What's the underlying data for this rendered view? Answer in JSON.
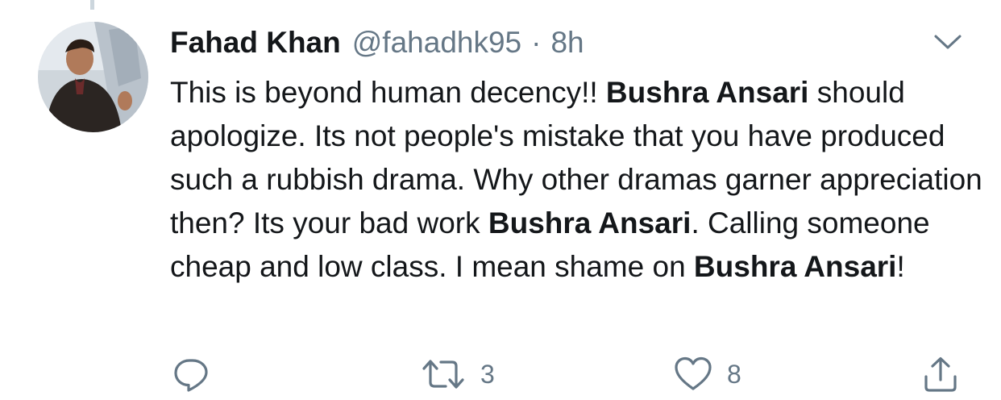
{
  "tweet": {
    "author_name": "Fahad Khan",
    "handle": "@fahadhk95",
    "separator": "·",
    "time": "8h",
    "text_parts": [
      {
        "text": "This is beyond human decency!! ",
        "bold": false
      },
      {
        "text": "Bushra Ansari",
        "bold": true
      },
      {
        "text": " should apologize. Its not people's mistake that you have produced such a rubbish drama. Why other dramas garner appreciation then? Its your bad work ",
        "bold": false
      },
      {
        "text": "Bushra Ansari",
        "bold": true
      },
      {
        "text": ". Calling someone cheap and low class. I mean shame on ",
        "bold": false
      },
      {
        "text": "Bushra Ansari",
        "bold": true
      },
      {
        "text": "!",
        "bold": false
      }
    ]
  },
  "actions": {
    "reply_icon": "reply-icon",
    "retweet_icon": "retweet-icon",
    "retweet_count": "3",
    "like_icon": "heart-icon",
    "like_count": "8",
    "share_icon": "share-icon"
  },
  "colors": {
    "text_primary": "#14171a",
    "text_secondary": "#657786",
    "thread_line": "#ccd6dd"
  }
}
